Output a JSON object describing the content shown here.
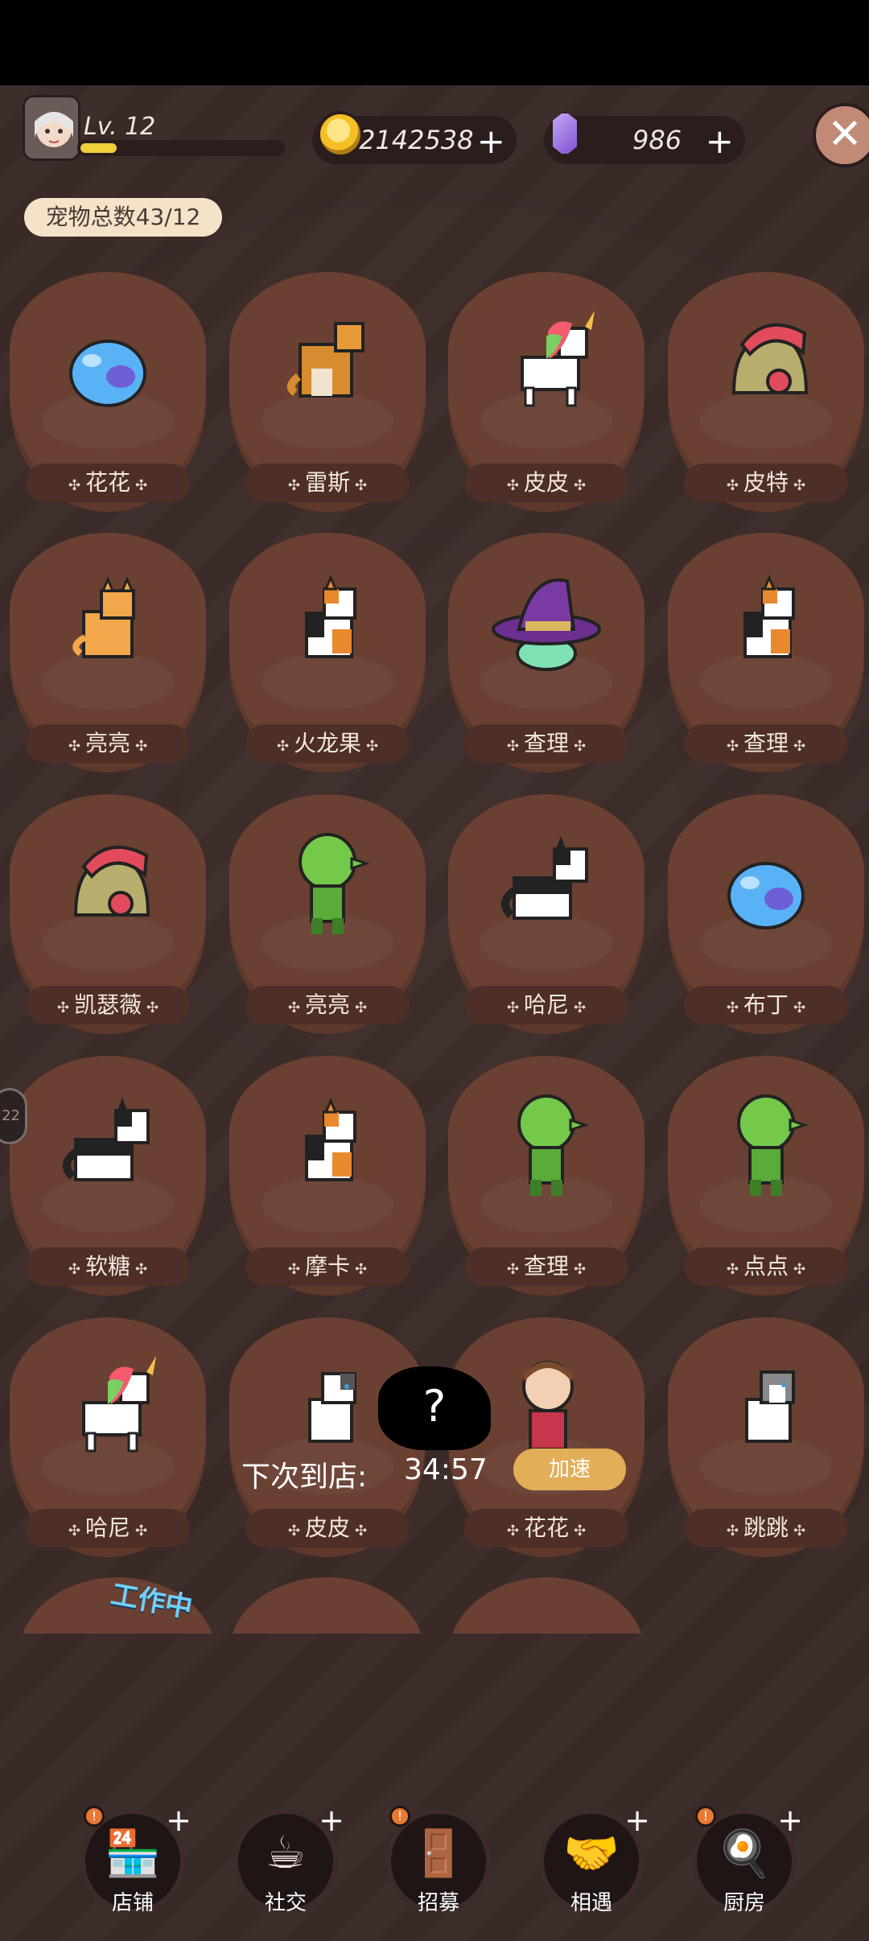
{
  "hud": {
    "level_label": "Lv. 12",
    "level_progress": 0.18,
    "coins": "2142538",
    "gems": "986",
    "coin_plus": "+",
    "gem_plus": "+",
    "close_glyph": "✕",
    "avatar_icon": "character-avatar-icon",
    "coin_icon": "coin-icon",
    "gem_icon": "purple-gem-icon"
  },
  "pets_total": "宠物总数43/12",
  "pets": [
    {
      "name": "花花",
      "icon": "blue-slime"
    },
    {
      "name": "雷斯",
      "icon": "shiba-dog"
    },
    {
      "name": "皮皮",
      "icon": "rainbow-unicorn"
    },
    {
      "name": "皮特",
      "icon": "red-helmet"
    },
    {
      "name": "亮亮",
      "icon": "orange-cat"
    },
    {
      "name": "火龙果",
      "icon": "calico-cat"
    },
    {
      "name": "查理",
      "icon": "witch-hat"
    },
    {
      "name": "查理",
      "icon": "calico-cat"
    },
    {
      "name": "凯瑟薇",
      "icon": "red-helmet"
    },
    {
      "name": "亮亮",
      "icon": "green-goblin"
    },
    {
      "name": "哈尼",
      "icon": "husky-dog"
    },
    {
      "name": "布丁",
      "icon": "blue-slime"
    },
    {
      "name": "软糖",
      "icon": "husky-dog"
    },
    {
      "name": "摩卡",
      "icon": "calico-cat"
    },
    {
      "name": "查理",
      "icon": "green-goblin"
    },
    {
      "name": "点点",
      "icon": "green-goblin"
    },
    {
      "name": "哈尼",
      "icon": "rainbow-unicorn"
    },
    {
      "name": "皮皮",
      "icon": "white-cat"
    },
    {
      "name": "花花",
      "icon": "monkey-kid"
    },
    {
      "name": "跳跳",
      "icon": "gray-cat"
    }
  ],
  "arrival": {
    "label": "下次到店:",
    "time": "34:57",
    "speed_button": "加速",
    "mystery_mark": "?"
  },
  "working_tag": "工作中",
  "side_handle": "22",
  "nav": [
    {
      "label": "店铺",
      "icon": "shop-icon",
      "glyph": "🏪",
      "badge": "!",
      "plus": "+"
    },
    {
      "label": "社交",
      "icon": "coffee-cup-icon",
      "glyph": "☕",
      "badge": "",
      "plus": "+"
    },
    {
      "label": "招募",
      "icon": "recruit-door-icon",
      "glyph": "🚪",
      "badge": "!",
      "plus": ""
    },
    {
      "label": "相遇",
      "icon": "handshake-icon",
      "glyph": "🤝",
      "badge": "",
      "plus": "+"
    },
    {
      "label": "厨房",
      "icon": "frying-pan-icon",
      "glyph": "🍳",
      "badge": "!",
      "plus": "+"
    }
  ]
}
